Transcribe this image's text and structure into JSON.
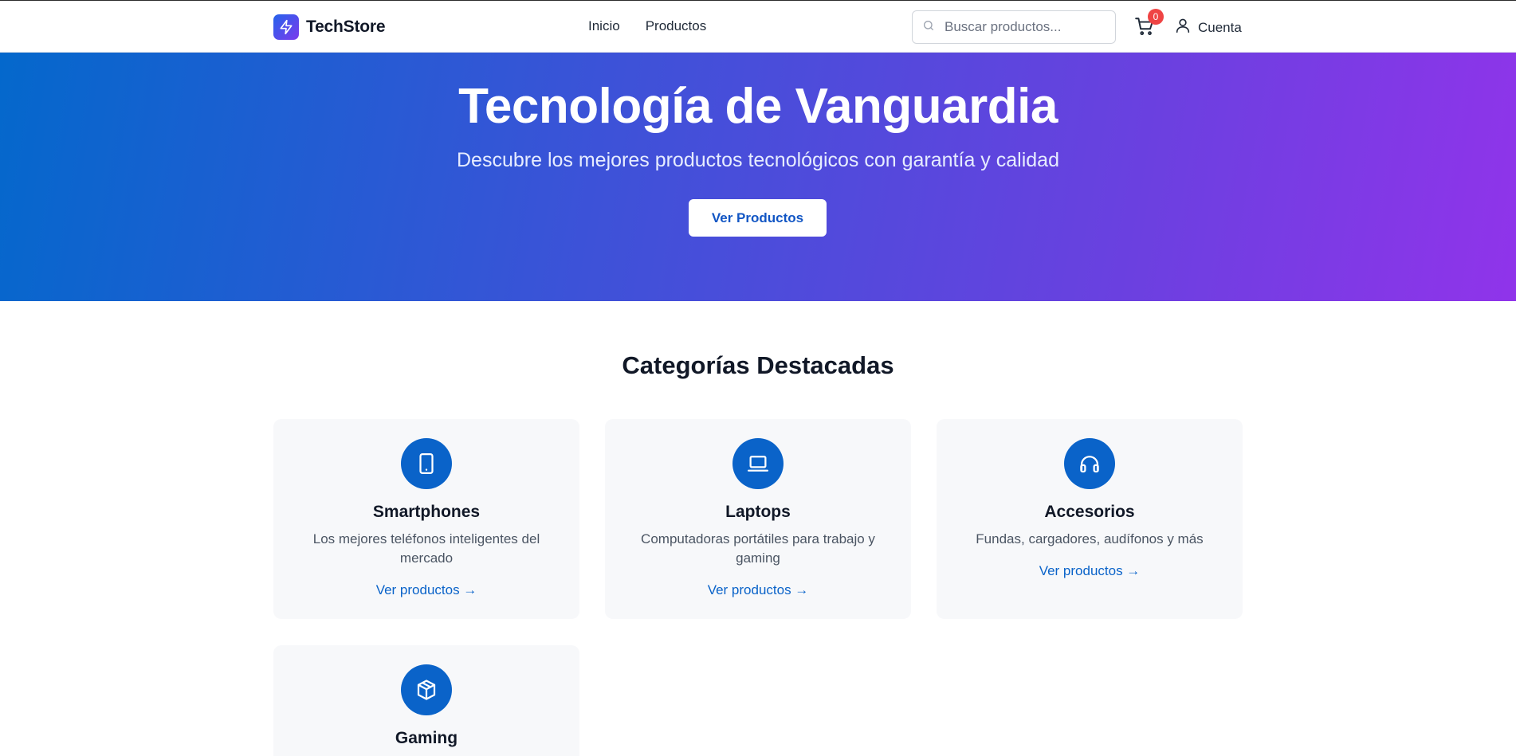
{
  "header": {
    "brand": "TechStore",
    "nav": [
      "Inicio",
      "Productos"
    ],
    "search_placeholder": "Buscar productos...",
    "cart_count": "0",
    "account_label": "Cuenta"
  },
  "hero": {
    "title": "Tecnología de Vanguardia",
    "subtitle": "Descubre los mejores productos tecnológicos con garantía y calidad",
    "cta": "Ver Productos"
  },
  "categories": {
    "title": "Categorías Destacadas",
    "items": [
      {
        "name": "Smartphones",
        "description": "Los mejores teléfonos inteligentes del mercado",
        "link": "Ver productos →",
        "icon": "smartphone-icon"
      },
      {
        "name": "Laptops",
        "description": "Computadoras portátiles para trabajo y gaming",
        "link": "Ver productos →",
        "icon": "laptop-icon"
      },
      {
        "name": "Accesorios",
        "description": "Fundas, cargadores, audífonos y más",
        "link": "Ver productos →",
        "icon": "headphones-icon"
      },
      {
        "name": "Gaming",
        "description": "",
        "link": "",
        "icon": "package-icon"
      }
    ]
  },
  "colors": {
    "accent": "#0a63c9",
    "badge": "#ef4444",
    "hero_start": "#0468cc",
    "hero_end": "#9034ea"
  }
}
